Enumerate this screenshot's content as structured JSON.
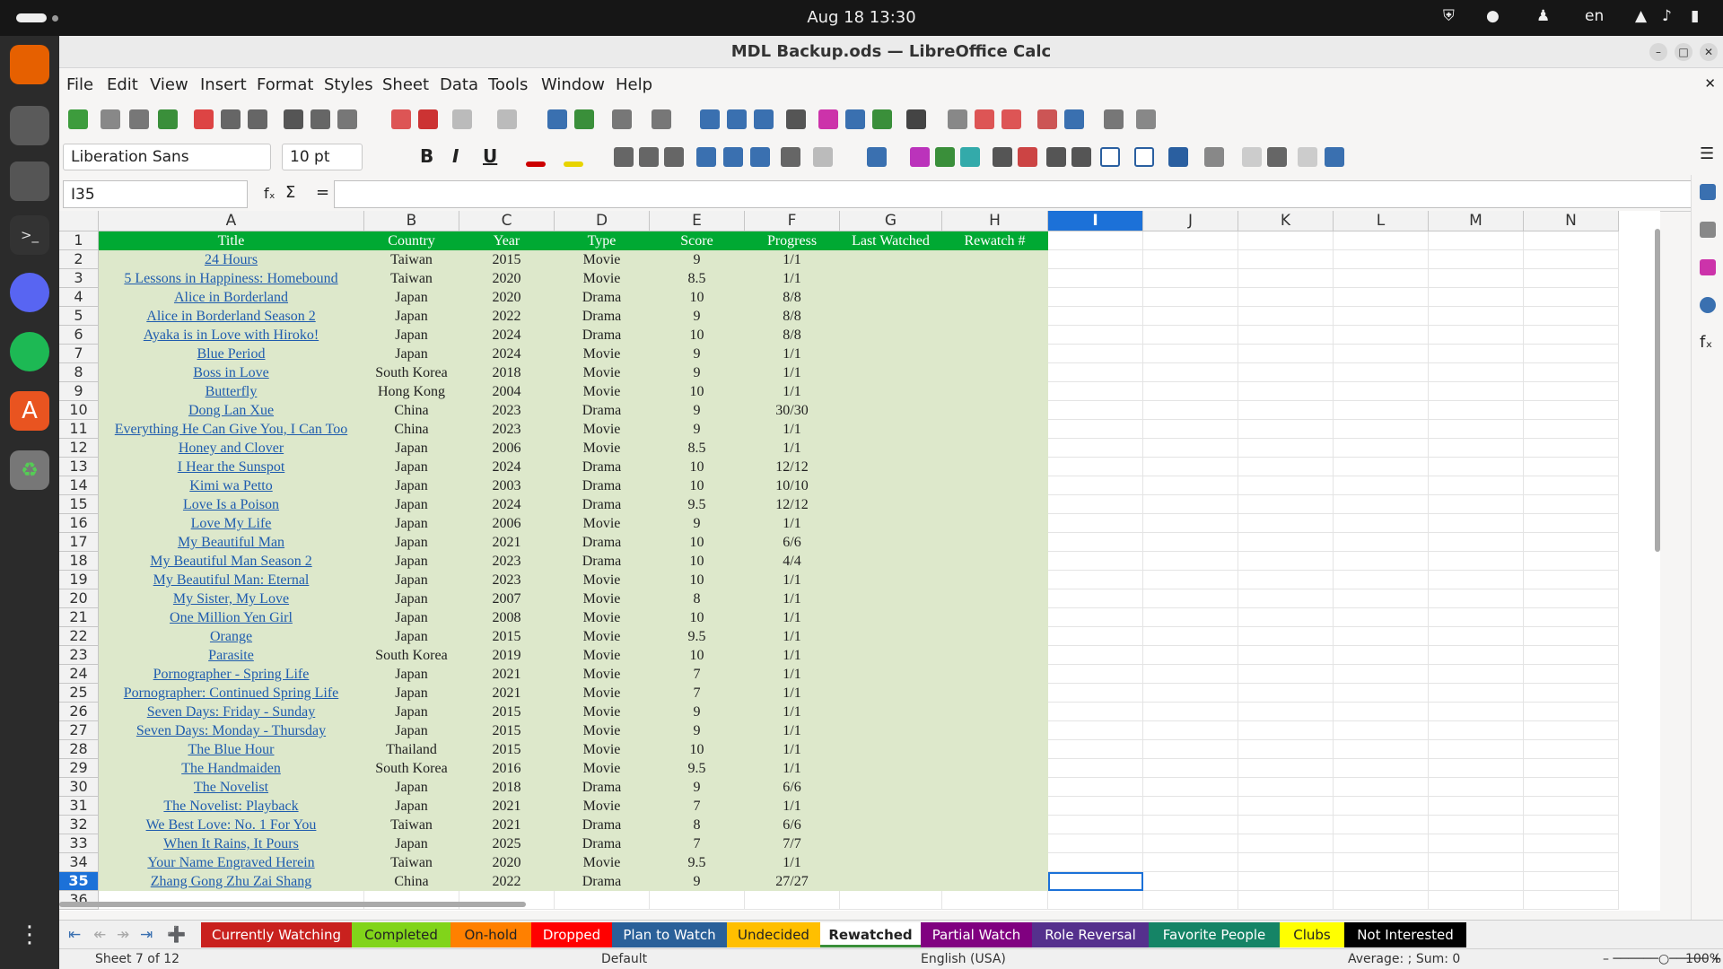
{
  "system": {
    "clock": "Aug 18  13:30",
    "lang": "en"
  },
  "window": {
    "title": "MDL Backup.ods — LibreOffice Calc"
  },
  "menu": [
    "File",
    "Edit",
    "View",
    "Insert",
    "Format",
    "Styles",
    "Sheet",
    "Data",
    "Tools",
    "Window",
    "Help"
  ],
  "toolbar": {
    "font_name": "Liberation Sans",
    "font_size": "10 pt",
    "bold": "B",
    "italic": "I",
    "underline": "U"
  },
  "formula_bar": {
    "name_box": "I35",
    "formula": "",
    "fx": "fₓ",
    "sum": "Σ",
    "eq": "="
  },
  "columns": [
    "A",
    "B",
    "C",
    "D",
    "E",
    "F",
    "G",
    "H",
    "I",
    "J",
    "K",
    "L",
    "M",
    "N"
  ],
  "header": [
    "Title",
    "Country",
    "Year",
    "Type",
    "Score",
    "Progress",
    "Last Watched",
    "Rewatch #"
  ],
  "rows": [
    [
      "24 Hours",
      "Taiwan",
      "2015",
      "Movie",
      "9",
      "1/1"
    ],
    [
      "5 Lessons in Happiness: Homebound",
      "Taiwan",
      "2020",
      "Movie",
      "8.5",
      "1/1"
    ],
    [
      "Alice in Borderland",
      "Japan",
      "2020",
      "Drama",
      "10",
      "8/8"
    ],
    [
      "Alice in Borderland Season 2",
      "Japan",
      "2022",
      "Drama",
      "9",
      "8/8"
    ],
    [
      "Ayaka is in Love with Hiroko!",
      "Japan",
      "2024",
      "Drama",
      "10",
      "8/8"
    ],
    [
      "Blue Period",
      "Japan",
      "2024",
      "Movie",
      "9",
      "1/1"
    ],
    [
      "Boss in Love",
      "South Korea",
      "2018",
      "Movie",
      "9",
      "1/1"
    ],
    [
      "Butterfly",
      "Hong Kong",
      "2004",
      "Movie",
      "10",
      "1/1"
    ],
    [
      "Dong Lan Xue",
      "China",
      "2023",
      "Drama",
      "9",
      "30/30"
    ],
    [
      "Everything He Can Give You, I Can Too",
      "China",
      "2023",
      "Movie",
      "9",
      "1/1"
    ],
    [
      "Honey and Clover",
      "Japan",
      "2006",
      "Movie",
      "8.5",
      "1/1"
    ],
    [
      "I Hear the Sunspot",
      "Japan",
      "2024",
      "Drama",
      "10",
      "12/12"
    ],
    [
      "Kimi wa Petto",
      "Japan",
      "2003",
      "Drama",
      "10",
      "10/10"
    ],
    [
      "Love Is a Poison",
      "Japan",
      "2024",
      "Drama",
      "9.5",
      "12/12"
    ],
    [
      "Love My Life",
      "Japan",
      "2006",
      "Movie",
      "9",
      "1/1"
    ],
    [
      "My Beautiful Man",
      "Japan",
      "2021",
      "Drama",
      "10",
      "6/6"
    ],
    [
      "My Beautiful Man Season 2",
      "Japan",
      "2023",
      "Drama",
      "10",
      "4/4"
    ],
    [
      "My Beautiful Man: Eternal",
      "Japan",
      "2023",
      "Movie",
      "10",
      "1/1"
    ],
    [
      "My Sister, My Love",
      "Japan",
      "2007",
      "Movie",
      "8",
      "1/1"
    ],
    [
      "One Million Yen Girl",
      "Japan",
      "2008",
      "Movie",
      "10",
      "1/1"
    ],
    [
      "Orange",
      "Japan",
      "2015",
      "Movie",
      "9.5",
      "1/1"
    ],
    [
      "Parasite",
      "South Korea",
      "2019",
      "Movie",
      "10",
      "1/1"
    ],
    [
      "Pornographer - Spring Life",
      "Japan",
      "2021",
      "Movie",
      "7",
      "1/1"
    ],
    [
      "Pornographer: Continued Spring Life",
      "Japan",
      "2021",
      "Movie",
      "7",
      "1/1"
    ],
    [
      "Seven Days: Friday - Sunday",
      "Japan",
      "2015",
      "Movie",
      "9",
      "1/1"
    ],
    [
      "Seven Days: Monday - Thursday",
      "Japan",
      "2015",
      "Movie",
      "9",
      "1/1"
    ],
    [
      "The Blue Hour",
      "Thailand",
      "2015",
      "Movie",
      "10",
      "1/1"
    ],
    [
      "The Handmaiden",
      "South Korea",
      "2016",
      "Movie",
      "9.5",
      "1/1"
    ],
    [
      "The Novelist",
      "Japan",
      "2018",
      "Drama",
      "9",
      "6/6"
    ],
    [
      "The Novelist: Playback",
      "Japan",
      "2021",
      "Movie",
      "7",
      "1/1"
    ],
    [
      "We Best Love: No. 1 For You",
      "Taiwan",
      "2021",
      "Drama",
      "8",
      "6/6"
    ],
    [
      "When It Rains, It Pours",
      "Japan",
      "2025",
      "Drama",
      "7",
      "7/7"
    ],
    [
      "Your Name Engraved Herein",
      "Taiwan",
      "2020",
      "Movie",
      "9.5",
      "1/1"
    ],
    [
      "Zhang Gong Zhu Zai Shang",
      "China",
      "2022",
      "Drama",
      "9",
      "27/27"
    ]
  ],
  "row_numbers": [
    "1",
    "2",
    "3",
    "4",
    "5",
    "6",
    "7",
    "8",
    "9",
    "10",
    "11",
    "12",
    "13",
    "14",
    "15",
    "16",
    "17",
    "18",
    "19",
    "20",
    "21",
    "22",
    "23",
    "24",
    "25",
    "26",
    "27",
    "28",
    "29",
    "30",
    "31",
    "32",
    "33",
    "34",
    "35",
    "36"
  ],
  "tabs": [
    {
      "label": "Currently Watching",
      "color": "#c9211e",
      "text": "#fff"
    },
    {
      "label": "Completed",
      "color": "#81d41a",
      "text": "#222"
    },
    {
      "label": "On-hold",
      "color": "#ff8000",
      "text": "#222"
    },
    {
      "label": "Dropped",
      "color": "#ff0000",
      "text": "#fff"
    },
    {
      "label": "Plan to Watch",
      "color": "#2a6099",
      "text": "#fff"
    },
    {
      "label": "Undecided",
      "color": "#ffbf00",
      "text": "#222"
    },
    {
      "label": "Rewatched",
      "color": "#ffffff",
      "text": "#222"
    },
    {
      "label": "Partial Watch",
      "color": "#800080",
      "text": "#fff"
    },
    {
      "label": "Role Reversal",
      "color": "#55308d",
      "text": "#fff"
    },
    {
      "label": "Favorite People",
      "color": "#158466",
      "text": "#fff"
    },
    {
      "label": "Clubs",
      "color": "#ffff00",
      "text": "#222"
    },
    {
      "label": "Not Interested",
      "color": "#000000",
      "text": "#fff"
    }
  ],
  "status": {
    "sheet": "Sheet 7 of 12",
    "style": "Default",
    "language": "English (USA)",
    "sum": "Average: ; Sum: 0",
    "zoom": "100%"
  },
  "colors": {
    "header_green": "#00a933",
    "data_fill": "#dde8cb",
    "link": "#1f5cae",
    "active": "#1c71d8"
  }
}
